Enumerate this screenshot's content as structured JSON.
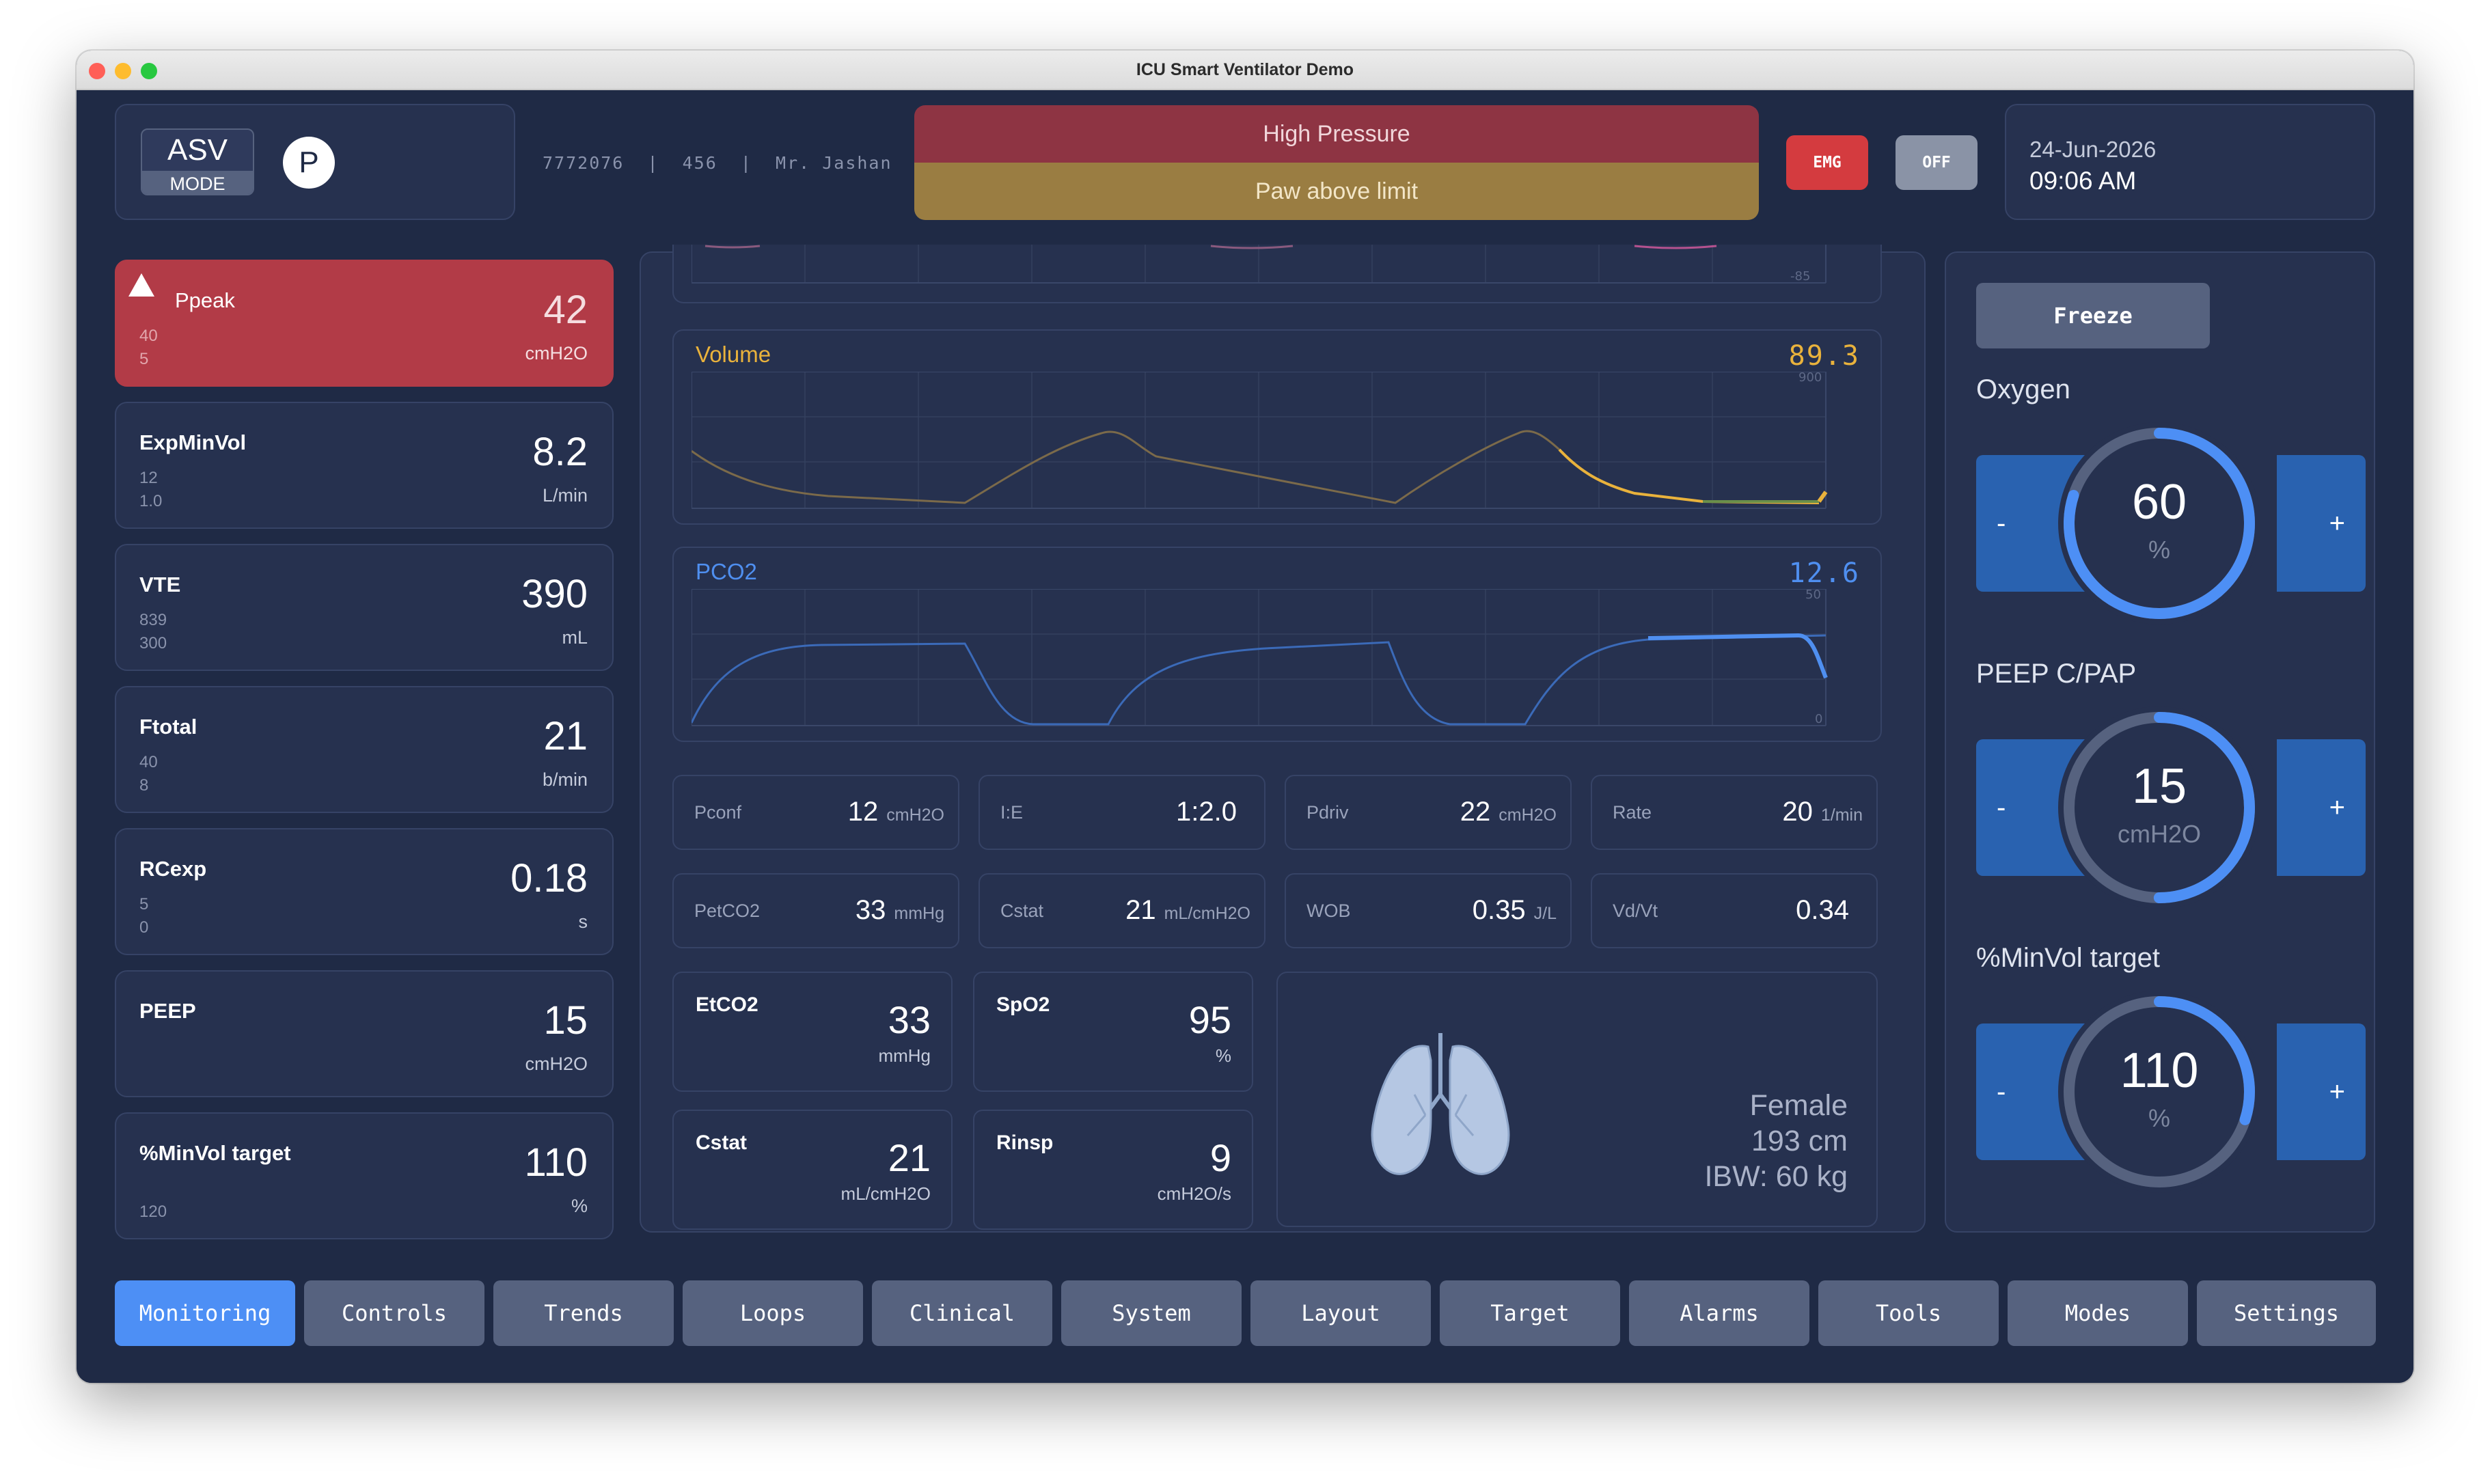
{
  "window": {
    "title": "ICU Smart Ventilator Demo"
  },
  "header": {
    "mode": "ASV",
    "mode_label": "MODE",
    "patient_type": "P",
    "patient_info": "7772076  |  456  |  Mr. Jashan",
    "alarm_primary": "High Pressure",
    "alarm_secondary": "Paw above limit",
    "emg_label": "EMG",
    "off_label": "OFF",
    "date": "24-Jun-2026",
    "time": "09:06 AM"
  },
  "params": [
    {
      "name": "Ppeak",
      "high": "40",
      "low": "5",
      "value": "42",
      "unit": "cmH2O",
      "alarm": true
    },
    {
      "name": "ExpMinVol",
      "high": "12",
      "low": "1.0",
      "value": "8.2",
      "unit": "L/min"
    },
    {
      "name": "VTE",
      "high": "839",
      "low": "300",
      "value": "390",
      "unit": "mL"
    },
    {
      "name": "Ftotal",
      "high": "40",
      "low": "8",
      "value": "21",
      "unit": "b/min"
    },
    {
      "name": "RCexp",
      "high": "5",
      "low": "0",
      "value": "0.18",
      "unit": "s"
    },
    {
      "name": "PEEP",
      "high": "",
      "low": "",
      "value": "15",
      "unit": "cmH2O"
    },
    {
      "name": "%MinVol target",
      "high": "",
      "low": "120",
      "value": "110",
      "unit": "%"
    }
  ],
  "waves": {
    "pressure": {
      "axis_bottom": "-85"
    },
    "volume": {
      "label": "Volume",
      "value": "89.3",
      "axis_top": "900",
      "color": "#e9b23c"
    },
    "pco2": {
      "label": "PCO2",
      "value": "12.6",
      "axis_top": "50",
      "axis_bottom": "0",
      "color": "#4f8ff0"
    }
  },
  "metrics": [
    {
      "name": "Pconf",
      "value": "12",
      "unit": "cmH2O"
    },
    {
      "name": "I:E",
      "value": "1:2.0",
      "unit": ""
    },
    {
      "name": "Pdriv",
      "value": "22",
      "unit": "cmH2O"
    },
    {
      "name": "Rate",
      "value": "20",
      "unit": "1/min"
    },
    {
      "name": "PetCO2",
      "value": "33",
      "unit": "mmHg"
    },
    {
      "name": "Cstat",
      "value": "21",
      "unit": "mL/cmH2O"
    },
    {
      "name": "WOB",
      "value": "0.35",
      "unit": "J/L"
    },
    {
      "name": "Vd/Vt",
      "value": "0.34",
      "unit": ""
    }
  ],
  "vitals": [
    {
      "name": "EtCO2",
      "value": "33",
      "unit": "mmHg"
    },
    {
      "name": "SpO2",
      "value": "95",
      "unit": "%"
    },
    {
      "name": "Cstat",
      "value": "21",
      "unit": "mL/cmH2O"
    },
    {
      "name": "Rinsp",
      "value": "9",
      "unit": "cmH2O/s"
    }
  ],
  "patient": {
    "sex": "Female",
    "height": "193 cm",
    "ibw": "IBW: 60 kg"
  },
  "controls": {
    "freeze_label": "Freeze",
    "items": [
      {
        "title": "Oxygen",
        "value": "60",
        "unit": "%",
        "level": 0.8
      },
      {
        "title": "PEEP C/PAP",
        "value": "15",
        "unit": "cmH2O",
        "level": 0.5
      },
      {
        "title": "%MinVol target",
        "value": "110",
        "unit": "%",
        "level": 0.3
      }
    ],
    "minus": "-",
    "plus": "+"
  },
  "tabs": [
    {
      "label": "Monitoring",
      "active": true
    },
    {
      "label": "Controls"
    },
    {
      "label": "Trends"
    },
    {
      "label": "Loops"
    },
    {
      "label": "Clinical"
    },
    {
      "label": "System"
    },
    {
      "label": "Layout"
    },
    {
      "label": "Target"
    },
    {
      "label": "Alarms"
    },
    {
      "label": "Tools"
    },
    {
      "label": "Modes"
    },
    {
      "label": "Settings"
    }
  ],
  "colors": {
    "background": "#1f2a45",
    "card": "#26314f",
    "alarm_red": "#b23b47",
    "alarm_yellow": "#9a7d42",
    "accent_blue": "#4d8ff5",
    "volume": "#e9b23c",
    "pco2": "#4f8ff0"
  }
}
